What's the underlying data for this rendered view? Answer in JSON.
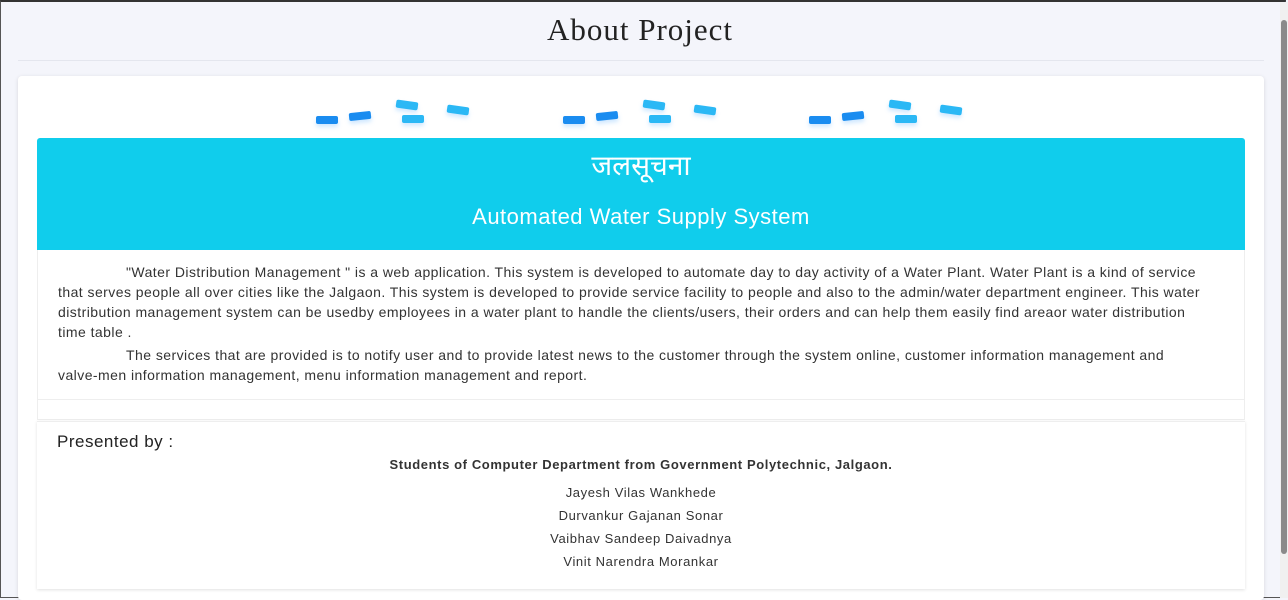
{
  "page": {
    "title": "About Project"
  },
  "banner": {
    "hindi_title": "जलसूचना",
    "subtitle": "Automated Water Supply System",
    "color": "#10cdec"
  },
  "about": {
    "paragraph_1": "\"Water Distribution Management \" is a web application. This system is developed to automate day to day activity of a Water Plant. Water Plant is a kind of service that serves people all over cities like the Jalgaon. This system is developed to provide service facility to people and also to the admin/water department engineer. This water distribution management system can be usedby employees in a water plant to handle the clients/users, their orders and can help them easily find areaor water distribution time table .",
    "paragraph_2": "The services that are provided is to notify user and to provide latest news to the customer through the system online, customer information management and valve-men information management, menu information management and report."
  },
  "presenters": {
    "heading": "Presented by :",
    "department": "Students of Computer Department from Government Polytechnic, Jalgaon.",
    "students": [
      "Jayesh Vilas Wankhede",
      "Durvankur Gajanan Sonar",
      "Vaibhav Sandeep Daivadnya",
      "Vinit Narendra Morankar"
    ]
  },
  "decor": {
    "icon": "water-drops-icon",
    "colors": [
      "#1a8cf0",
      "#2bb8f5"
    ]
  }
}
